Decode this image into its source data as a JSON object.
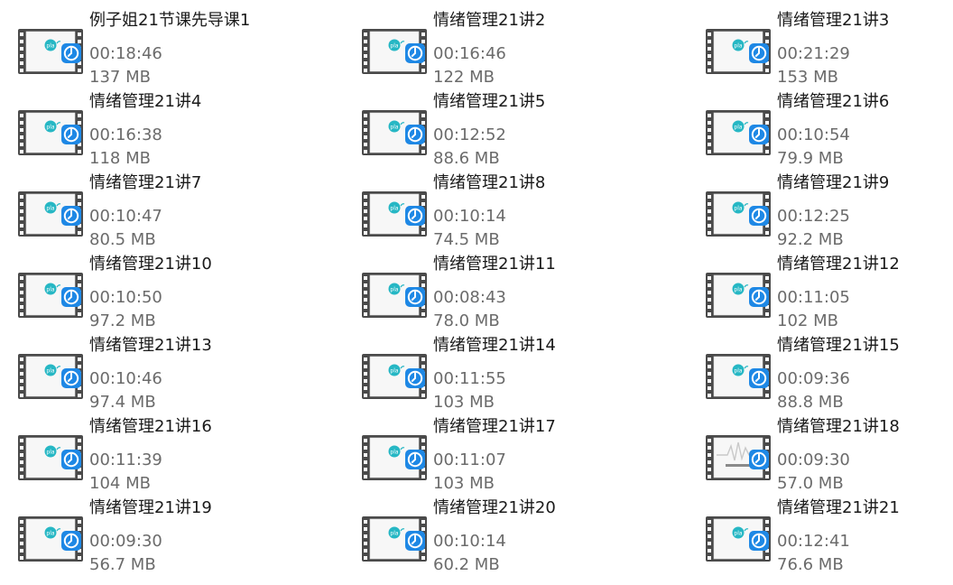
{
  "colors": {
    "badge_blue": "#1e88e5",
    "logo_teal": "#26b7c4",
    "film_frame": "#4a4a4a",
    "title_text": "#1a1a1a",
    "meta_text": "#6b6b6b"
  },
  "icons": {
    "thumbnail": "video-film-thumbnail-icon",
    "badge": "video-player-badge-icon"
  },
  "files": [
    {
      "name": "例子姐21节课先导课1",
      "duration": "00:18:46",
      "size": "137 MB"
    },
    {
      "name": "情绪管理21讲2",
      "duration": "00:16:46",
      "size": "122 MB"
    },
    {
      "name": "情绪管理21讲3",
      "duration": "00:21:29",
      "size": "153 MB"
    },
    {
      "name": "情绪管理21讲4",
      "duration": "00:16:38",
      "size": "118 MB"
    },
    {
      "name": "情绪管理21讲5",
      "duration": "00:12:52",
      "size": "88.6 MB"
    },
    {
      "name": "情绪管理21讲6",
      "duration": "00:10:54",
      "size": "79.9 MB"
    },
    {
      "name": "情绪管理21讲7",
      "duration": "00:10:47",
      "size": "80.5 MB"
    },
    {
      "name": "情绪管理21讲8",
      "duration": "00:10:14",
      "size": "74.5 MB"
    },
    {
      "name": "情绪管理21讲9",
      "duration": "00:12:25",
      "size": "92.2 MB"
    },
    {
      "name": "情绪管理21讲10",
      "duration": "00:10:50",
      "size": "97.2 MB"
    },
    {
      "name": "情绪管理21讲11",
      "duration": "00:08:43",
      "size": "78.0 MB"
    },
    {
      "name": "情绪管理21讲12",
      "duration": "00:11:05",
      "size": "102 MB"
    },
    {
      "name": "情绪管理21讲13",
      "duration": "00:10:46",
      "size": "97.4 MB"
    },
    {
      "name": "情绪管理21讲14",
      "duration": "00:11:55",
      "size": "103 MB"
    },
    {
      "name": "情绪管理21讲15",
      "duration": "00:09:36",
      "size": "88.8 MB"
    },
    {
      "name": "情绪管理21讲16",
      "duration": "00:11:39",
      "size": "104 MB"
    },
    {
      "name": "情绪管理21讲17",
      "duration": "00:11:07",
      "size": "103 MB"
    },
    {
      "name": "情绪管理21讲18",
      "duration": "00:09:30",
      "size": "57.0 MB"
    },
    {
      "name": "情绪管理21讲19",
      "duration": "00:09:30",
      "size": "56.7 MB"
    },
    {
      "name": "情绪管理21讲20",
      "duration": "00:10:14",
      "size": "60.2 MB"
    },
    {
      "name": "情绪管理21讲21",
      "duration": "00:12:41",
      "size": "76.6 MB"
    }
  ]
}
